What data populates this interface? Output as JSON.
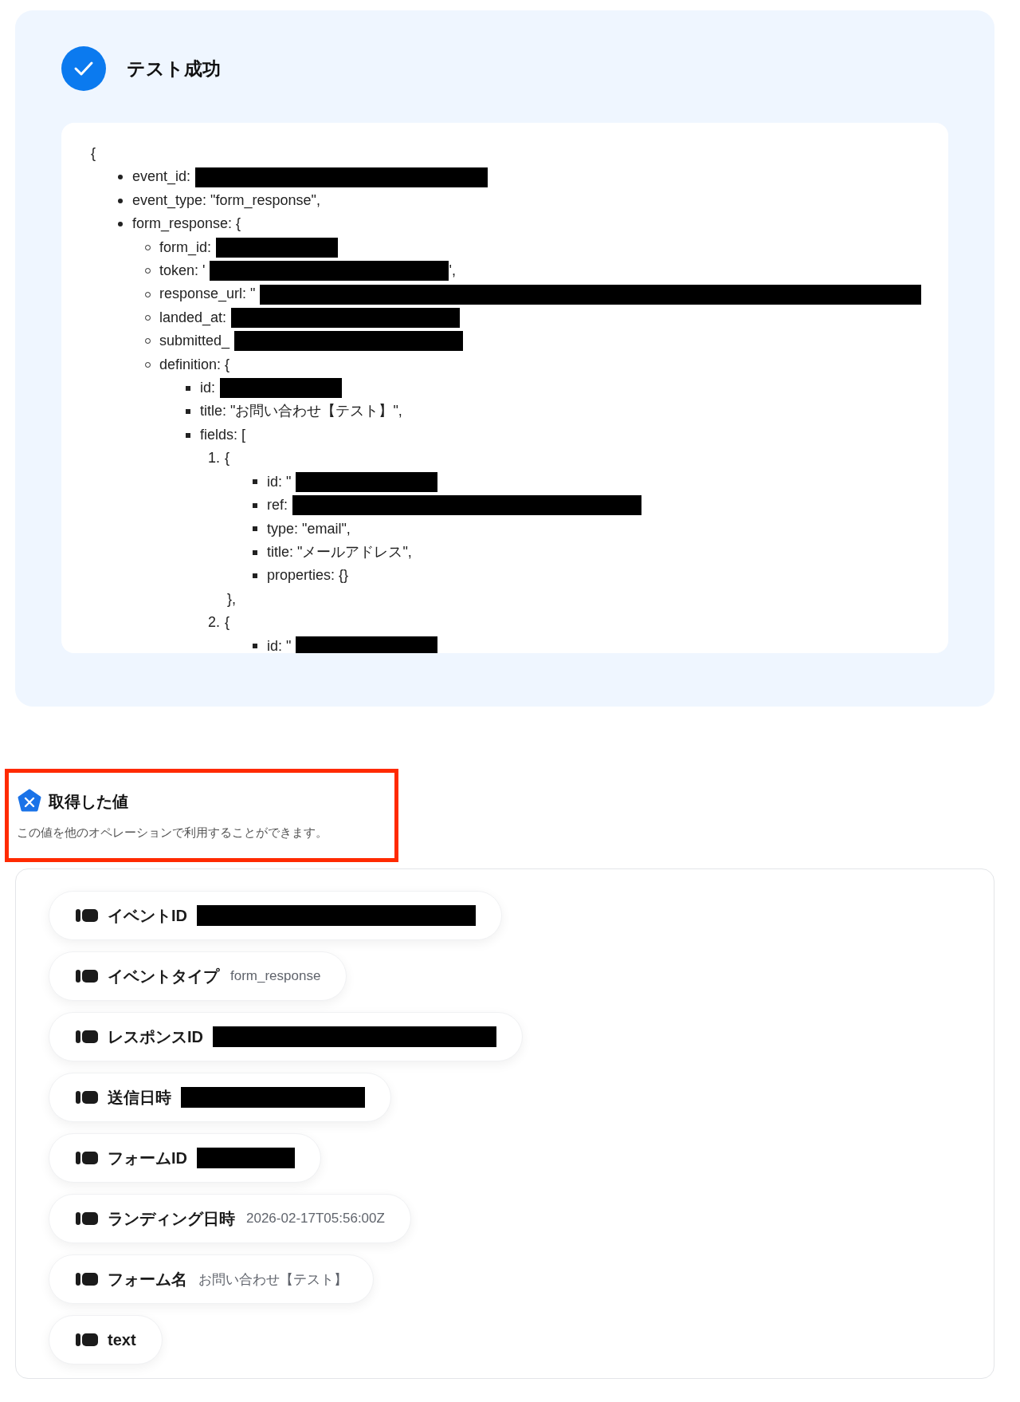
{
  "test_result": {
    "title": "テスト成功",
    "code": {
      "open": "{",
      "items": [
        {
          "text": "event_id:",
          "redacted": true
        },
        {
          "text": "event_type: \"form_response\","
        },
        {
          "text": "form_response: {",
          "children": [
            {
              "text": "form_id:",
              "redacted": true
            },
            {
              "text": "token: '",
              "redacted": true,
              "after": "',"
            },
            {
              "text": "response_url: \"",
              "redacted": true
            },
            {
              "text": "landed_at:",
              "redacted": true
            },
            {
              "text": "submitted_",
              "redacted": true
            },
            {
              "text": "definition: {",
              "children": [
                {
                  "text": "id:",
                  "redacted": true
                },
                {
                  "text": "title: \"お問い合わせ【テスト】\","
                },
                {
                  "text": "fields: [",
                  "children": [
                    {
                      "marker": "1.",
                      "text": "{",
                      "close": "},",
                      "children": [
                        {
                          "text": "id: \"",
                          "redacted": true
                        },
                        {
                          "text": "ref:",
                          "redacted": true
                        },
                        {
                          "text": "type: \"email\","
                        },
                        {
                          "text": "title: \"メールアドレス\","
                        },
                        {
                          "text": "properties: {}"
                        }
                      ]
                    },
                    {
                      "marker": "2.",
                      "text": "{",
                      "children": [
                        {
                          "text": "id: \"",
                          "redacted": true
                        }
                      ]
                    }
                  ]
                }
              ]
            }
          ]
        }
      ]
    }
  },
  "acquired_values": {
    "title": "取得した値",
    "description": "この値を他のオペレーションで利用することができます。",
    "items": [
      {
        "label": "イベントID",
        "redacted": true
      },
      {
        "label": "イベントタイプ",
        "value": "form_response"
      },
      {
        "label": "レスポンスID",
        "redacted": true
      },
      {
        "label": "送信日時",
        "redacted": true
      },
      {
        "label": "フォームID",
        "redacted": true
      },
      {
        "label": "ランディング日時",
        "value": "2026-02-17T05:56:00Z"
      },
      {
        "label": "フォーム名",
        "value": "お問い合わせ【テスト】"
      },
      {
        "label": "text"
      }
    ]
  }
}
